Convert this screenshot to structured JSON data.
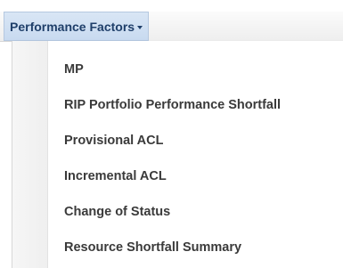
{
  "menu_bar": {
    "trigger_label": "Performance Factors"
  },
  "dropdown": {
    "items": [
      {
        "label": "MP"
      },
      {
        "label": "RIP Portfolio Performance Shortfall"
      },
      {
        "label": "Provisional ACL"
      },
      {
        "label": "Incremental ACL"
      },
      {
        "label": "Change of Status"
      },
      {
        "label": "Resource Shortfall Summary"
      }
    ]
  },
  "colors": {
    "trigger_background": "#c8daf0",
    "trigger_text": "#1f3f6a",
    "item_text": "#3a3a3a"
  },
  "icons": {
    "trigger_caret": "caret-down-icon"
  }
}
